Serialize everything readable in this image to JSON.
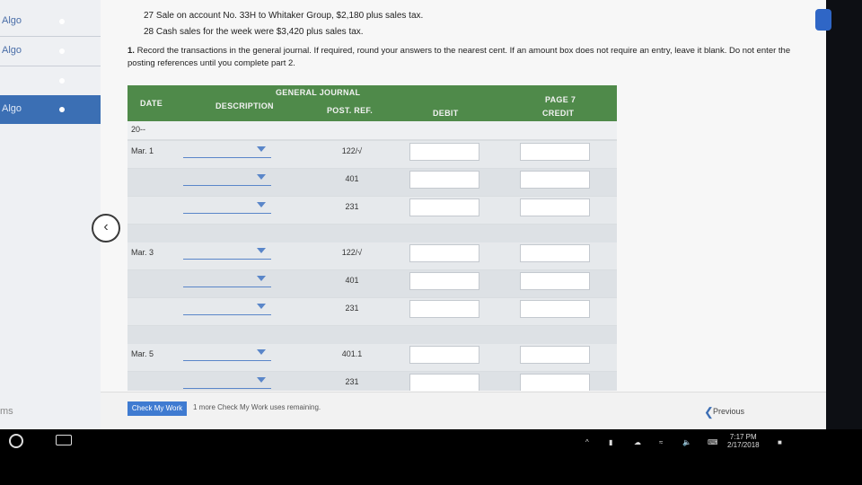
{
  "sidebar": {
    "items": [
      {
        "label": "Algo"
      },
      {
        "label": "Algo"
      },
      {
        "label": ""
      },
      {
        "label": "Algo"
      }
    ],
    "footer_label": "ms"
  },
  "question": {
    "line27": "27 Sale on account No. 33H to Whitaker Group, $2,180 plus sales tax.",
    "line28": "28 Cash sales for the week were $3,420 plus sales tax.",
    "instruction_bold": "1.",
    "instruction_text": " Record the transactions in the general journal. If required, round your answers to the nearest cent. If an amount box does not require an entry, leave it blank. Do not enter the posting references until you complete part 2."
  },
  "journal": {
    "title": "GENERAL JOURNAL",
    "page_label": "PAGE 7",
    "headers": {
      "date": "DATE",
      "description": "DESCRIPTION",
      "post_ref": "POST. REF.",
      "debit": "DEBIT",
      "credit": "CREDIT"
    },
    "year": "20--",
    "rows": [
      {
        "date": "Mar. 1",
        "ref": "122/√"
      },
      {
        "date": "",
        "ref": "401"
      },
      {
        "date": "",
        "ref": "231"
      },
      {
        "date": "Mar. 3",
        "ref": "122/√"
      },
      {
        "date": "",
        "ref": "401"
      },
      {
        "date": "",
        "ref": "231"
      },
      {
        "date": "Mar. 5",
        "ref": "401.1"
      },
      {
        "date": "",
        "ref": "231"
      }
    ]
  },
  "footer": {
    "check_button": "Check My Work",
    "check_note": "1 more Check My Work uses remaining.",
    "previous": "Previous"
  },
  "taskbar": {
    "time": "7:17 PM",
    "date": "2/17/2018"
  }
}
